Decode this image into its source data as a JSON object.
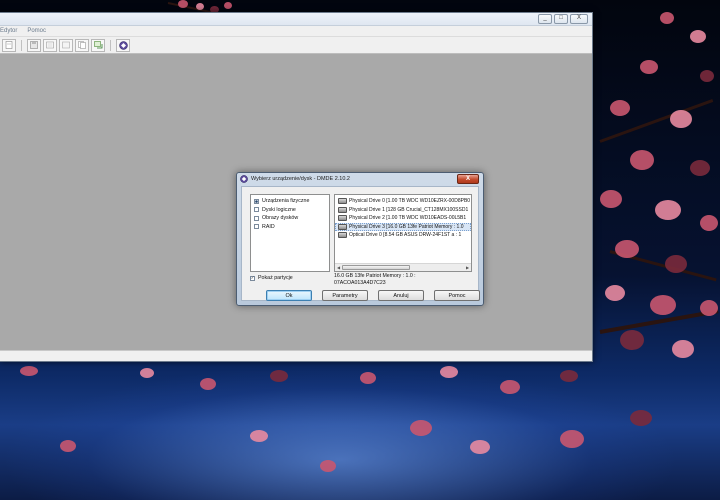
{
  "app": {
    "window_controls": [
      "_",
      "□",
      "X"
    ],
    "menu": [
      "Edytor",
      "Pomoc"
    ],
    "toolbar_icons": [
      "file-icon",
      "disk-icon",
      "edit-icon",
      "list-icon",
      "copy-icon",
      "refresh-icon",
      "dmde-icon"
    ]
  },
  "dialog": {
    "title": "Wybierz urządzenie/dysk - DMDE 2.10.2",
    "close_label": "X",
    "categories": [
      {
        "label": "Urządzenia fizyczne",
        "selected": true
      },
      {
        "label": "Dyski logiczne",
        "selected": false
      },
      {
        "label": "Obrazy dysków",
        "selected": false
      },
      {
        "label": "RAID",
        "selected": false
      }
    ],
    "drives": [
      {
        "label": "Physical Drive 0 [1.00 TB WDC WD10EZRX-00D8PB0"
      },
      {
        "label": "Physical Drive 1 [128 GB Crucial_CT128MX100SSD1"
      },
      {
        "label": "Physical Drive 2 [1.00 TB WDC WD10EADS-00L5B1"
      },
      {
        "label": "Physical Drive 3 [16.0 GB 13fe Patriot Memory : 1.0"
      },
      {
        "label": "Optical Drive 0 [8.54 GB ASUS     DRW-24F1ST   a : 1"
      }
    ],
    "selected_drive_index": 3,
    "show_partitions_label": "Pokaż partycje",
    "show_partitions_checked": "✓",
    "selection_info_line1": "16.0 GB 13fe Patriot Memory : 1.0 :",
    "selection_info_line2": "07ACOA013A4D7C23",
    "buttons": {
      "ok": "Ok",
      "params": "Parametry",
      "cancel": "Anuluj",
      "help": "Pomoc"
    },
    "scroll_left": "◀",
    "scroll_right": "▶"
  }
}
